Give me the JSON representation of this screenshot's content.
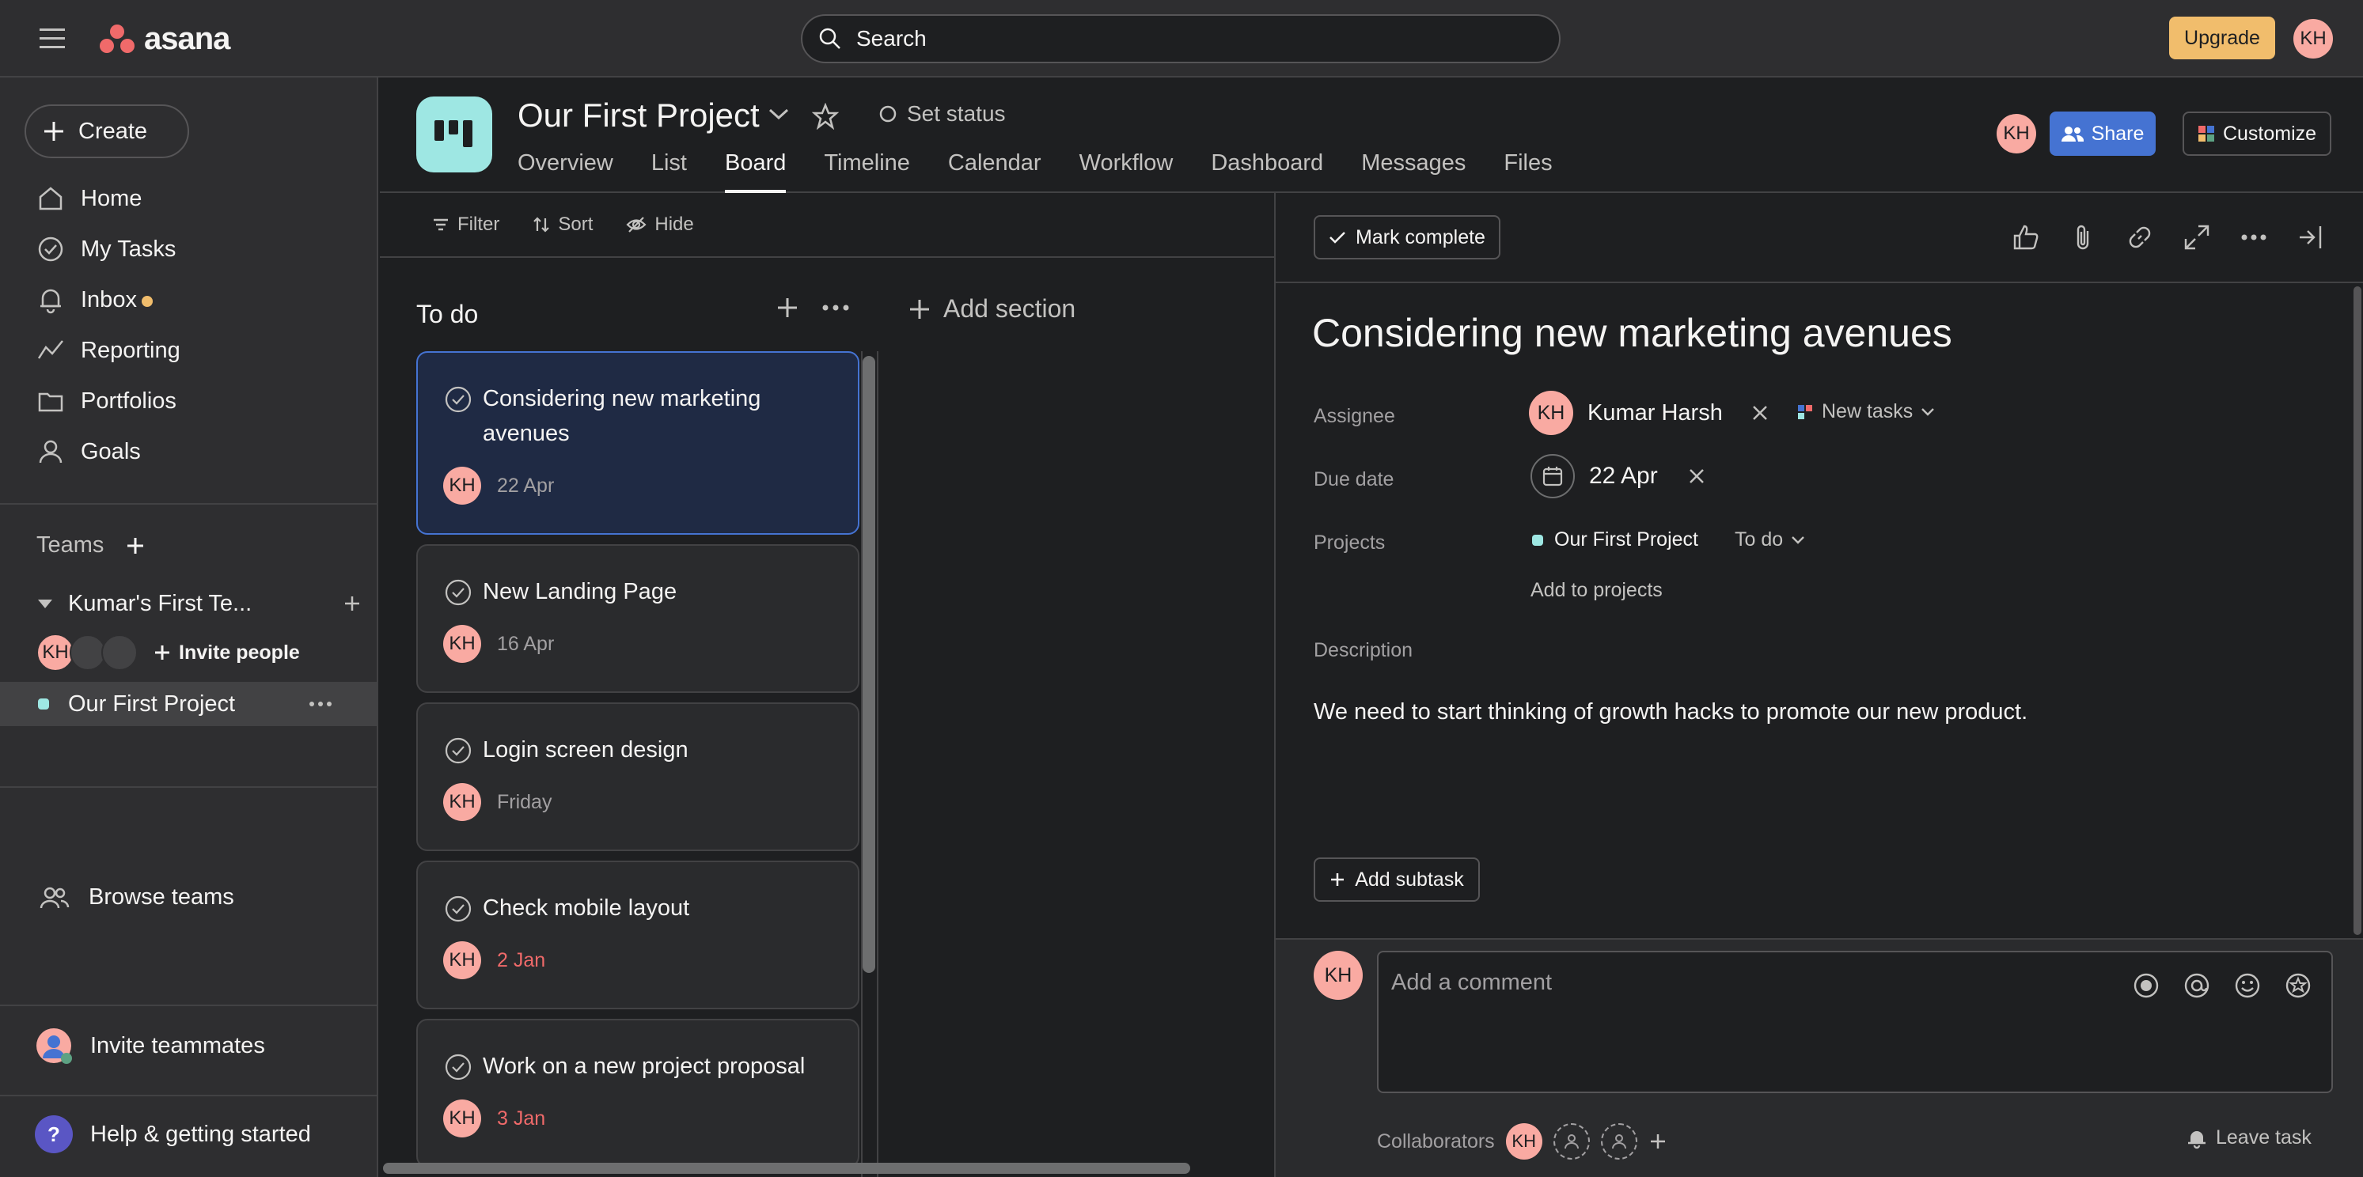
{
  "topbar": {
    "logo_text": "asana",
    "search_placeholder": "Search",
    "upgrade_label": "Upgrade",
    "user_initials": "KH"
  },
  "sidebar": {
    "create_label": "Create",
    "nav": [
      {
        "label": "Home",
        "icon": "home-icon"
      },
      {
        "label": "My Tasks",
        "icon": "check-circle-icon"
      },
      {
        "label": "Inbox",
        "icon": "bell-icon"
      },
      {
        "label": "Reporting",
        "icon": "chart-line-icon"
      },
      {
        "label": "Portfolios",
        "icon": "folder-icon"
      },
      {
        "label": "Goals",
        "icon": "person-icon"
      }
    ],
    "teams_label": "Teams",
    "team_name": "Kumar's First Te...",
    "member_initials": "KH",
    "invite_people_label": "Invite people",
    "project_name": "Our First Project",
    "browse_teams_label": "Browse teams",
    "invite_teammates_label": "Invite teammates",
    "help_label": "Help & getting started",
    "help_glyph": "?"
  },
  "project": {
    "title": "Our First Project",
    "set_status_label": "Set status",
    "tabs": [
      "Overview",
      "List",
      "Board",
      "Timeline",
      "Calendar",
      "Workflow",
      "Dashboard",
      "Messages",
      "Files"
    ],
    "active_tab": "Board",
    "member_initials": "KH",
    "share_label": "Share",
    "customize_label": "Customize"
  },
  "board": {
    "toolbar": {
      "filter": "Filter",
      "sort": "Sort",
      "hide": "Hide"
    },
    "column_title": "To do",
    "add_section_label": "Add section",
    "cards": [
      {
        "title": "Considering new marketing avenues",
        "assignee": "KH",
        "due": "22 Apr",
        "overdue": false,
        "selected": true
      },
      {
        "title": "New Landing Page",
        "assignee": "KH",
        "due": "16 Apr",
        "overdue": false,
        "selected": false
      },
      {
        "title": "Login screen design",
        "assignee": "KH",
        "due": "Friday",
        "overdue": false,
        "selected": false
      },
      {
        "title": "Check mobile layout",
        "assignee": "KH",
        "due": "2 Jan",
        "overdue": true,
        "selected": false
      },
      {
        "title": "Work on a new project proposal",
        "assignee": "KH",
        "due": "3 Jan",
        "overdue": true,
        "selected": false
      }
    ]
  },
  "task": {
    "mark_complete_label": "Mark complete",
    "title": "Considering new marketing avenues",
    "labels": {
      "assignee": "Assignee",
      "due_date": "Due date",
      "projects": "Projects",
      "description": "Description"
    },
    "assignee_initials": "KH",
    "assignee_name": "Kumar Harsh",
    "assignee_section": "New tasks",
    "due_date": "22 Apr",
    "project_name": "Our First Project",
    "project_section": "To do",
    "add_to_projects_label": "Add to projects",
    "description": "We need to start thinking of growth hacks to promote our new product.",
    "add_subtask_label": "Add subtask",
    "comment_avatar": "KH",
    "comment_placeholder": "Add a comment",
    "collaborators_label": "Collaborators",
    "collaborator_initials": "KH",
    "leave_task_label": "Leave task"
  },
  "colors": {
    "background": "#1e1f21",
    "panel": "#2e2e30",
    "accent_blue": "#4573d2",
    "upgrade": "#f1bd6c",
    "avatar": "#f9aaa2",
    "project_color": "#9ee7e3",
    "overdue": "#f06a6a"
  }
}
